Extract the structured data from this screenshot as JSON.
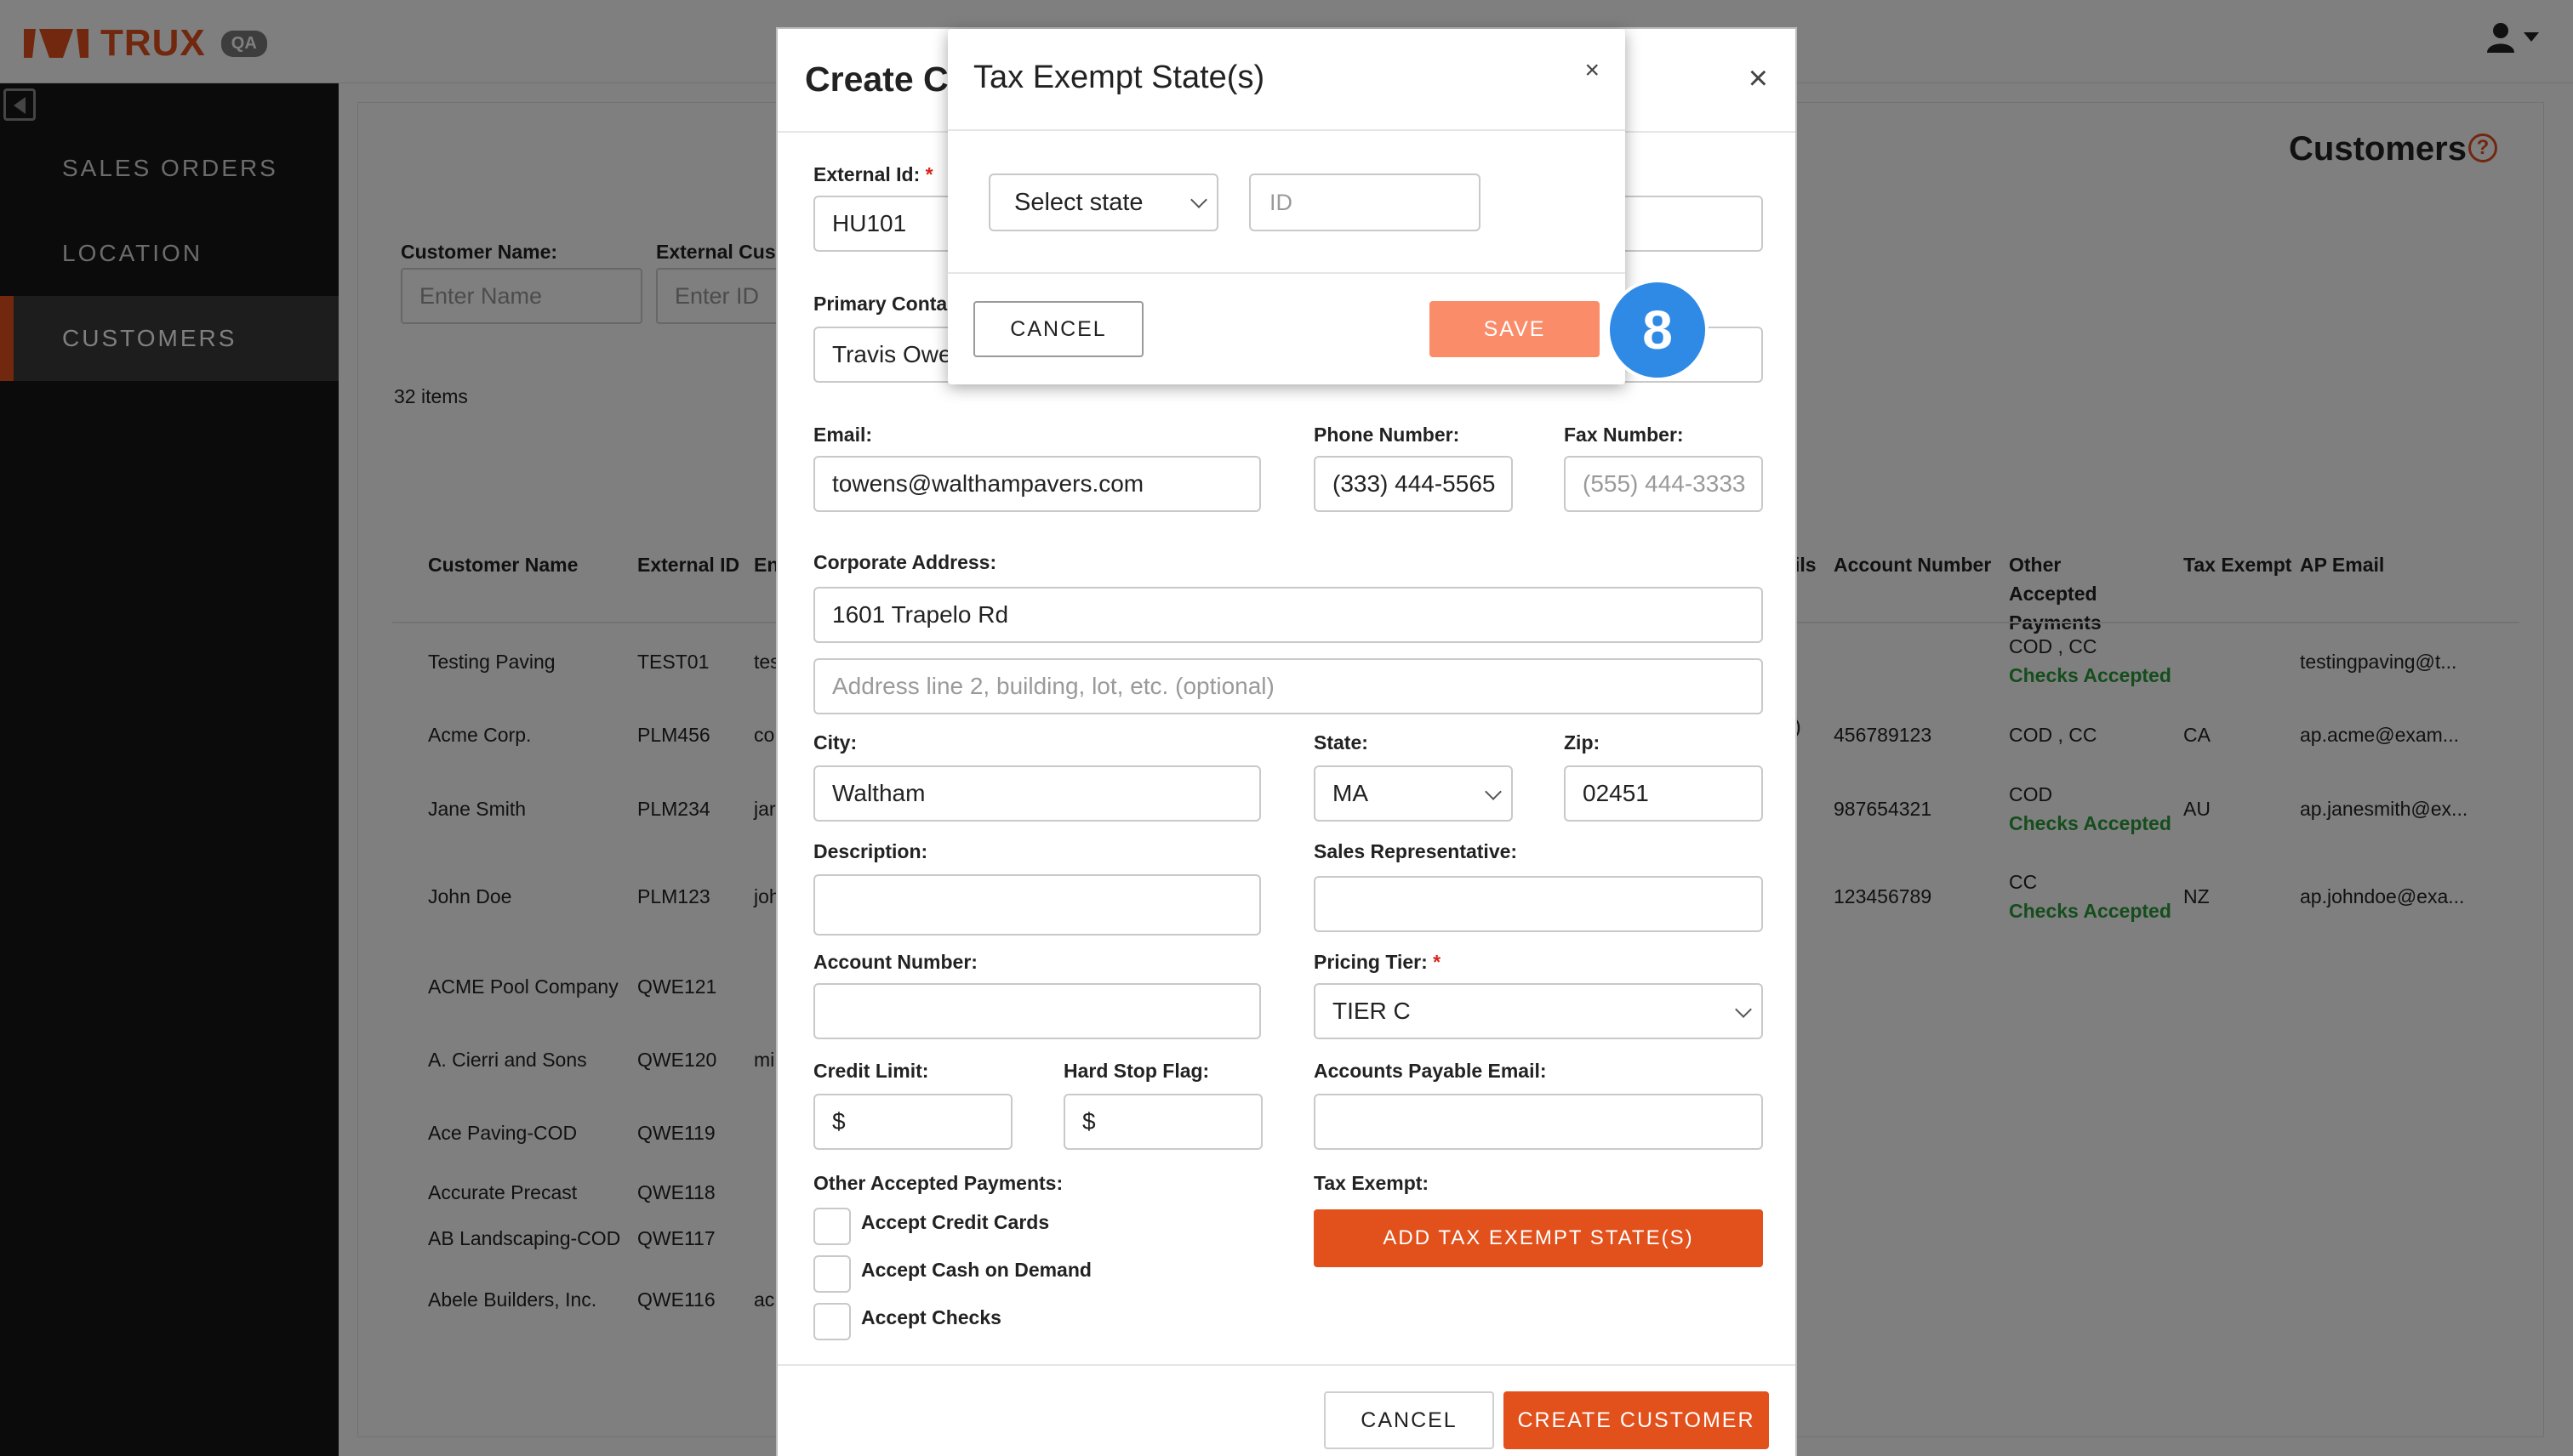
{
  "header": {
    "app_name": "TRUX",
    "env_badge": "QA",
    "logo_color": "#e2501c",
    "user_icon": "user-icon",
    "user_menu_icon": "caret-down-icon"
  },
  "sidebar": {
    "items": [
      {
        "label": "SALES ORDERS",
        "active": false
      },
      {
        "label": "LOCATION",
        "active": false
      },
      {
        "label": "CUSTOMERS",
        "active": true
      }
    ]
  },
  "page": {
    "title": "Customers",
    "help_icon": "?",
    "filters": {
      "customer_name_label": "Customer Name:",
      "customer_name_placeholder": "Enter Name",
      "external_id_label": "External Cus",
      "external_id_placeholder": "Enter ID"
    },
    "items_count": "32 items",
    "table": {
      "columns_left": [
        "Customer Name",
        "External ID",
        "En"
      ],
      "columns_right": [
        "ils",
        "Account Number",
        "Other Accepted Payments",
        "Tax Exempt",
        "AP Email"
      ],
      "rows": [
        {
          "name": "Testing Paving",
          "ext_id": "TEST01",
          "email_frag": "tes",
          "ils": "",
          "account": "",
          "payments": "COD , CC",
          "checks": "Checks Accepted",
          "tax": "",
          "ap_email": "testingpaving@t..."
        },
        {
          "name": "Acme Corp.",
          "ext_id": "PLM456",
          "email_frag": "co",
          "ils": ")",
          "account": "456789123",
          "payments": "COD , CC",
          "checks": "",
          "tax": "CA",
          "ap_email": "ap.acme@exam..."
        },
        {
          "name": "Jane Smith",
          "ext_id": "PLM234",
          "email_frag": "jar",
          "ils": "",
          "account": "987654321",
          "payments": "COD",
          "checks": "Checks Accepted",
          "tax": "AU",
          "ap_email": "ap.janesmith@ex..."
        },
        {
          "name": "John Doe",
          "ext_id": "PLM123",
          "email_frag": "joh",
          "ils": "",
          "account": "123456789",
          "payments": "CC",
          "checks": "Checks Accepted",
          "tax": "NZ",
          "ap_email": "ap.johndoe@exa..."
        },
        {
          "name": "ACME Pool Company",
          "ext_id": "QWE121",
          "email_frag": "",
          "ils": "",
          "account": "",
          "payments": "",
          "checks": "",
          "tax": "",
          "ap_email": ""
        },
        {
          "name": "A. Cierri and Sons",
          "ext_id": "QWE120",
          "email_frag": "mi",
          "ils": "",
          "account": "",
          "payments": "",
          "checks": "",
          "tax": "",
          "ap_email": ""
        },
        {
          "name": "Ace Paving-COD",
          "ext_id": "QWE119",
          "email_frag": "",
          "ils": "",
          "account": "",
          "payments": "",
          "checks": "",
          "tax": "",
          "ap_email": ""
        },
        {
          "name": "Accurate Precast",
          "ext_id": "QWE118",
          "email_frag": "",
          "ils": "",
          "account": "",
          "payments": "",
          "checks": "",
          "tax": "",
          "ap_email": ""
        },
        {
          "name": "AB Landscaping-COD",
          "ext_id": "QWE117",
          "email_frag": "",
          "ils": "",
          "account": "",
          "payments": "",
          "checks": "",
          "tax": "",
          "ap_email": ""
        },
        {
          "name": "Abele Builders, Inc.",
          "ext_id": "QWE116",
          "email_frag": "ac",
          "ils": "",
          "account": "",
          "payments": "",
          "checks": "",
          "tax": "",
          "ap_email": ""
        }
      ]
    }
  },
  "create_customer": {
    "title": "Create C",
    "close": "×",
    "external_id_label": "External Id:",
    "external_id_value": "HU101",
    "primary_contact_label": "Primary Conta",
    "primary_contact_value": "Travis Owe",
    "email_label": "Email:",
    "email_value": "towens@walthampavers.com",
    "phone_label": "Phone Number:",
    "phone_value": "(333) 444-5565",
    "fax_label": "Fax Number:",
    "fax_placeholder": "(555) 444-3333",
    "corporate_address_label": "Corporate Address:",
    "address1_value": "1601 Trapelo Rd",
    "address2_placeholder": "Address line 2, building, lot, etc. (optional)",
    "city_label": "City:",
    "city_value": "Waltham",
    "state_label": "State:",
    "state_value": "MA",
    "zip_label": "Zip:",
    "zip_value": "02451",
    "description_label": "Description:",
    "sales_rep_label": "Sales Representative:",
    "account_number_label": "Account Number:",
    "pricing_tier_label": "Pricing Tier:",
    "pricing_tier_value": "TIER C",
    "credit_limit_label": "Credit Limit:",
    "credit_limit_prefix": "$",
    "hard_stop_label": "Hard Stop Flag:",
    "hard_stop_prefix": "$",
    "ap_email_label": "Accounts Payable Email:",
    "other_payments_label": "Other Accepted Payments:",
    "accept_credit": "Accept Credit Cards",
    "accept_cod": "Accept Cash on Demand",
    "accept_checks": "Accept Checks",
    "tax_exempt_label": "Tax Exempt:",
    "add_tax_button": "ADD TAX EXEMPT STATE(S)",
    "cancel_button": "CANCEL",
    "create_button": "CREATE CUSTOMER",
    "required_mark": "*"
  },
  "tax_modal": {
    "title": "Tax Exempt State(s)",
    "close": "×",
    "state_select": "Select state",
    "id_placeholder": "ID",
    "cancel_button": "CANCEL",
    "save_button": "SAVE"
  },
  "step_badge": "8"
}
